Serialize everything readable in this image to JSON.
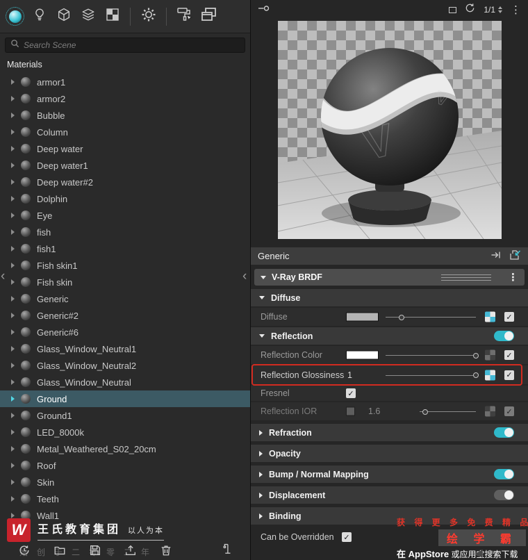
{
  "colors": {
    "accent": "#2fb9ca",
    "annotation": "#d22b20",
    "selected_row": "#3c5a64"
  },
  "left_panel": {
    "toolbar_icons": [
      "vray-materials-category",
      "lights-category",
      "geometry-category",
      "render-elements-category",
      "textures-category",
      "settings",
      "paint-roller-tool",
      "preview-window"
    ],
    "search_placeholder": "Search Scene",
    "section_title": "Materials",
    "materials": [
      {
        "name": "armor1"
      },
      {
        "name": "armor2"
      },
      {
        "name": "Bubble"
      },
      {
        "name": "Column"
      },
      {
        "name": "Deep water"
      },
      {
        "name": "Deep water1"
      },
      {
        "name": "Deep water#2"
      },
      {
        "name": "Dolphin"
      },
      {
        "name": "Eye"
      },
      {
        "name": "fish"
      },
      {
        "name": "fish1"
      },
      {
        "name": "Fish skin1"
      },
      {
        "name": "Fish skin"
      },
      {
        "name": "Generic"
      },
      {
        "name": "Generic#2"
      },
      {
        "name": "Generic#6"
      },
      {
        "name": "Glass_Window_Neutral1"
      },
      {
        "name": "Glass_Window_Neutral2"
      },
      {
        "name": "Glass_Window_Neutral"
      },
      {
        "name": "Ground",
        "selected": true
      },
      {
        "name": "Ground1"
      },
      {
        "name": "LED_8000k"
      },
      {
        "name": "Metal_Weathered_S02_20cm"
      },
      {
        "name": "Roof"
      },
      {
        "name": "Skin"
      },
      {
        "name": "Teeth"
      },
      {
        "name": "Wall1"
      }
    ],
    "footer_icons": [
      "history",
      "open-folder",
      "save",
      "import",
      "purge",
      "lamp-post"
    ],
    "logo": {
      "letter": "W",
      "brand": "王氏教育集团",
      "slogan": "以人为本",
      "faint_text": "始创于二零零二年"
    }
  },
  "right_panel": {
    "preview_toolbar": {
      "pages": "1/1",
      "icons": [
        "node-connection",
        "float-preview",
        "refresh-preview",
        "menu-dots"
      ]
    },
    "asset_header": {
      "title": "Generic",
      "icons": [
        "dock-arrow",
        "save-to-library"
      ]
    },
    "brdf_title": "V-Ray BRDF",
    "sections": {
      "diffuse": {
        "title": "Diffuse",
        "row": {
          "label": "Diffuse",
          "swatch": "#b4b4b4",
          "slider": 0.18,
          "checked": true
        }
      },
      "reflection": {
        "title": "Reflection",
        "toggle": "on",
        "color": {
          "label": "Reflection Color",
          "swatch": "#ffffff",
          "slider": 1,
          "checked": true
        },
        "glossiness": {
          "label": "Reflection Glossiness",
          "value": "1",
          "slider": 1,
          "checked": true
        },
        "fresnel": {
          "label": "Fresnel",
          "checked": true
        },
        "ior": {
          "label": "Reflection IOR",
          "swatch": "#9a9a9a",
          "value": "1.6",
          "slider": 0.1,
          "checked": true
        }
      },
      "refraction": {
        "title": "Refraction",
        "toggle": "on"
      },
      "opacity": {
        "title": "Opacity"
      },
      "bump": {
        "title": "Bump / Normal Mapping",
        "toggle": "on"
      },
      "displacement": {
        "title": "Displacement",
        "toggle": "muted"
      },
      "binding": {
        "title": "Binding"
      }
    },
    "override": {
      "label": "Can be Overridden",
      "checked": true
    }
  },
  "watermark": {
    "line1": "获 得 更 多 免 费 精 品 教 程",
    "line2": "绘 学 霸",
    "line3_bold": "在 AppStore",
    "line3_rest": "或应用宝搜索下载"
  }
}
